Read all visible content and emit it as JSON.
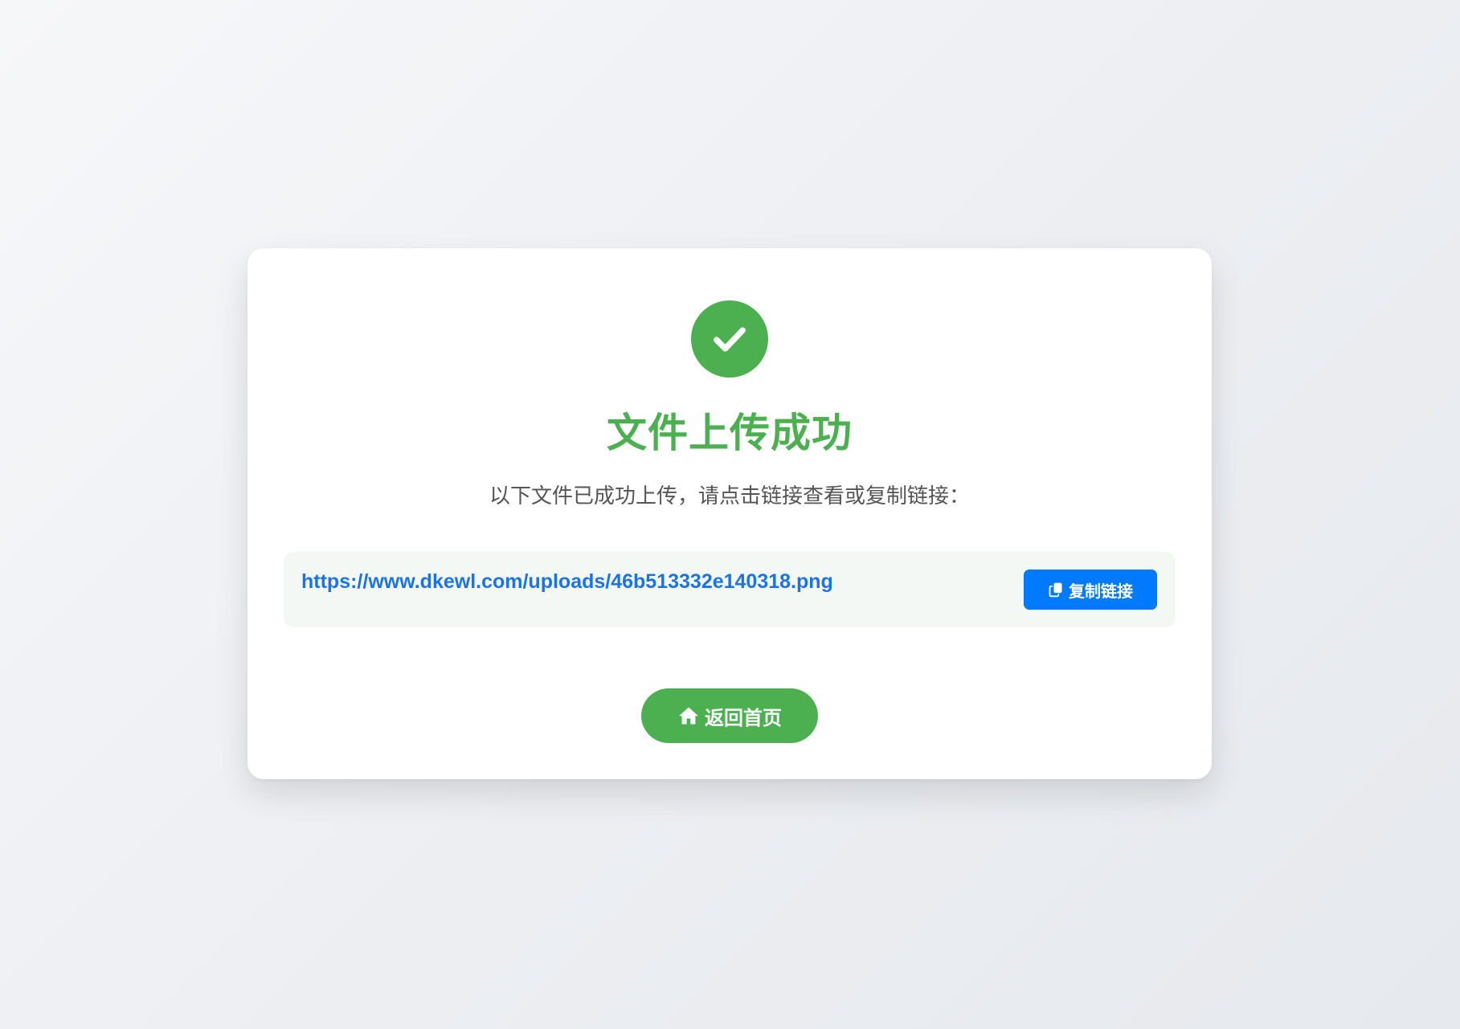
{
  "page": {
    "title": "文件上传成功",
    "subtitle": "以下文件已成功上传，请点击链接查看或复制链接："
  },
  "upload": {
    "link_text": "https://www.dkewl.com/uploads/46b513332e140318.png",
    "copy_label": "复制链接"
  },
  "actions": {
    "home_label": "返回首页"
  },
  "icons": {
    "status": "check-circle-icon",
    "copy": "copy-icon",
    "home": "home-icon"
  },
  "colors": {
    "success": "#4caf50",
    "link": "#1a73e8",
    "copy_button": "#007bff",
    "link_box_bg": "#f4f8f5"
  }
}
